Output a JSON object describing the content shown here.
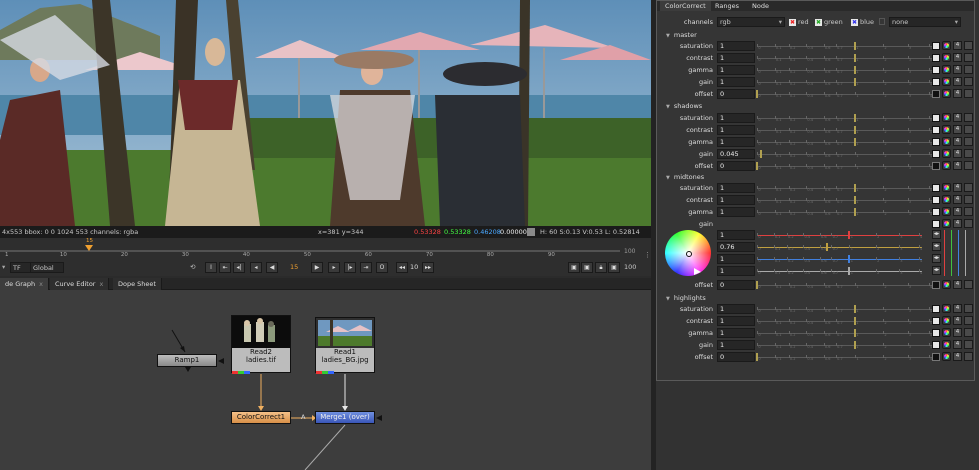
{
  "viewer": {
    "info_left": "4x553  bbox: 0 0 1024 553 channels: rgba",
    "info_coords": "x=381 y=344",
    "pixel_r": "0.53328",
    "pixel_g": "0.53328",
    "pixel_b": "0.46208",
    "pixel_a": "0.00000",
    "info_hsv": "H: 60 S:0.13 V:0.53  L: 0.52814",
    "colors": {
      "r": "#ff4444",
      "g": "#44ff44",
      "b": "#4aa8ff"
    }
  },
  "timeline": {
    "ticks": [
      "1",
      "10",
      "20",
      "30",
      "40",
      "50",
      "60",
      "70",
      "80",
      "90"
    ],
    "end_label": "100",
    "current_frame_marker": "15",
    "tf_label": "TF",
    "global_label": "Global",
    "current_frame": "15",
    "step_value": "10",
    "end_frame": "100",
    "end_frame_input": "100"
  },
  "tabs": [
    {
      "label": "de Graph",
      "close": "x"
    },
    {
      "label": "Curve Editor",
      "close": "x"
    },
    {
      "label": "Dope Sheet",
      "close": ""
    }
  ],
  "graph": {
    "nodes": {
      "ramp": "Ramp1",
      "read2_title": "Read2",
      "read2_file": "ladies.tif",
      "read1_title": "Read1",
      "read1_file": "ladies_BG.jpg",
      "colorcorrect": "ColorCorrect1",
      "merge": "Merge1 (over)",
      "pipe_label": "A"
    }
  },
  "props": {
    "tabs": [
      "ColorCorrect",
      "Ranges",
      "Node"
    ],
    "channels_label": "channels",
    "channels_value": "rgb",
    "chk_red": "red",
    "chk_green": "green",
    "chk_blue": "blue",
    "none_value": "none",
    "sections": {
      "master": {
        "title": "master",
        "rows": [
          {
            "label": "saturation",
            "value": "1",
            "level": 1
          },
          {
            "label": "contrast",
            "value": "1",
            "level": 1
          },
          {
            "label": "gamma",
            "value": "1",
            "level": 1
          },
          {
            "label": "gain",
            "value": "1",
            "level": 1
          },
          {
            "label": "offset",
            "value": "0",
            "level": 0
          }
        ]
      },
      "shadows": {
        "title": "shadows",
        "rows": [
          {
            "label": "saturation",
            "value": "1",
            "level": 1
          },
          {
            "label": "contrast",
            "value": "1",
            "level": 1
          },
          {
            "label": "gamma",
            "value": "1",
            "level": 1
          },
          {
            "label": "gain",
            "value": "0.045",
            "level": 0.045
          },
          {
            "label": "offset",
            "value": "0",
            "level": 0
          }
        ]
      },
      "midtones": {
        "title": "midtones",
        "rows": [
          {
            "label": "saturation",
            "value": "1",
            "level": 1
          },
          {
            "label": "contrast",
            "value": "1",
            "level": 1
          },
          {
            "label": "gamma",
            "value": "1",
            "level": 1
          },
          {
            "label": "gain",
            "value": "",
            "level": 1
          }
        ],
        "gain_rgba": [
          {
            "value": "1"
          },
          {
            "value": "0.76"
          },
          {
            "value": "1"
          },
          {
            "value": "1"
          }
        ],
        "offset": {
          "label": "offset",
          "value": "0"
        }
      },
      "highlights": {
        "title": "highlights",
        "rows": [
          {
            "label": "saturation",
            "value": "1",
            "level": 1
          },
          {
            "label": "contrast",
            "value": "1",
            "level": 1
          },
          {
            "label": "gamma",
            "value": "1",
            "level": 1
          },
          {
            "label": "gain",
            "value": "1",
            "level": 1
          },
          {
            "label": "offset",
            "value": "0",
            "level": 0
          }
        ]
      }
    },
    "slider_numbers": [
      "0",
      "0.1",
      "0.2",
      "0.4",
      "0.6",
      "0.7",
      "1",
      "2",
      "3",
      "4"
    ],
    "anim_button_label": "4"
  }
}
